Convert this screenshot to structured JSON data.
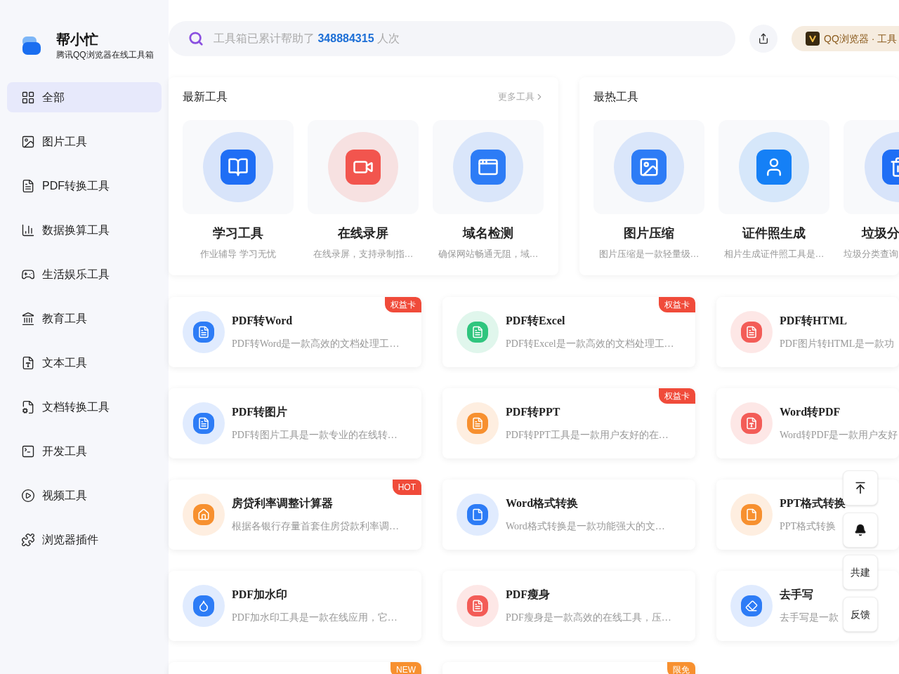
{
  "brand": {
    "name": "帮小忙",
    "subtitle": "腾讯QQ浏览器在线工具箱"
  },
  "sidebar": {
    "items": [
      {
        "label": "全部",
        "kind": "grid",
        "selected": true
      },
      {
        "label": "图片工具",
        "kind": "image",
        "selected": false
      },
      {
        "label": "PDF转换工具",
        "kind": "pdf",
        "selected": false
      },
      {
        "label": "数据换算工具",
        "kind": "chart",
        "selected": false
      },
      {
        "label": "生活娱乐工具",
        "kind": "life",
        "selected": false
      },
      {
        "label": "教育工具",
        "kind": "edu",
        "selected": false
      },
      {
        "label": "文本工具",
        "kind": "text",
        "selected": false
      },
      {
        "label": "文档转换工具",
        "kind": "doc",
        "selected": false
      },
      {
        "label": "开发工具",
        "kind": "code",
        "selected": false
      },
      {
        "label": "视频工具",
        "kind": "video",
        "selected": false
      },
      {
        "label": "浏览器插件",
        "kind": "plugin",
        "selected": false
      }
    ]
  },
  "search": {
    "prefix": "工具箱已累计帮助了",
    "count": "348884315",
    "suffix": "人次"
  },
  "promo": {
    "label": "QQ浏览器 · 工具"
  },
  "newest": {
    "title": "最新工具",
    "more": "更多工具",
    "items": [
      {
        "name": "学习工具",
        "desc": "作业辅导 学习无忧",
        "kind": "book",
        "color": "#1f6ef5"
      },
      {
        "name": "在线录屏",
        "desc": "在线录屏，支持录制指…",
        "kind": "video",
        "color": "#f2554e"
      },
      {
        "name": "域名检测",
        "desc": "确保网站畅通无阻，域…",
        "kind": "browser",
        "color": "#2d7cf6"
      }
    ]
  },
  "hottest": {
    "title": "最热工具",
    "items": [
      {
        "name": "图片压缩",
        "desc": "图片压缩是一款轻量级…",
        "kind": "image",
        "color": "#2d7cf6"
      },
      {
        "name": "证件照生成",
        "desc": "相片生成证件照工具是…",
        "kind": "person",
        "color": "#1580f6"
      },
      {
        "name": "垃圾分",
        "desc": "垃圾分类查询",
        "kind": "trash",
        "color": "#1f6ef5"
      }
    ]
  },
  "tools": [
    {
      "name": "PDF转Word",
      "desc": "PDF转Word是一款高效的文档处理工…",
      "kind": "pdf",
      "color": "#2d7cf6",
      "badge": {
        "text": "权益卡",
        "color": "#f04b3a"
      }
    },
    {
      "name": "PDF转Excel",
      "desc": "PDF转Excel是一款高效的文档处理工…",
      "kind": "pdf",
      "color": "#2fc57e",
      "badge": {
        "text": "权益卡",
        "color": "#f04b3a"
      }
    },
    {
      "name": "PDF转HTML",
      "desc": "PDF图片转HTML是一款功",
      "kind": "pdf",
      "color": "#f35c57"
    },
    {
      "name": "PDF转图片",
      "desc": "PDF转图片工具是一款专业的在线转…",
      "kind": "pdf",
      "color": "#2d7cf6"
    },
    {
      "name": "PDF转PPT",
      "desc": "PDF转PPT工具是一款用户友好的在…",
      "kind": "pdf",
      "color": "#f7902f",
      "badge": {
        "text": "权益卡",
        "color": "#f04b3a"
      }
    },
    {
      "name": "Word转PDF",
      "desc": "Word转PDF是一款用户友好",
      "kind": "word",
      "color": "#f35c57"
    },
    {
      "name": "房贷利率调整计算器",
      "desc": "根据各银行存量首套住房贷款利率调…",
      "kind": "house",
      "color": "#f7902f",
      "badge": {
        "text": "HOT",
        "color": "#f04b3a"
      }
    },
    {
      "name": "Word格式转换",
      "desc": "Word格式转换是一款功能强大的文…",
      "kind": "file",
      "color": "#2d7cf6"
    },
    {
      "name": "PPT格式转换",
      "desc": "PPT格式转换",
      "kind": "file",
      "color": "#f7902f"
    },
    {
      "name": "PDF加水印",
      "desc": "PDF加水印工具是一款在线应用，它…",
      "kind": "drop",
      "color": "#2d7cf6"
    },
    {
      "name": "PDF瘦身",
      "desc": "PDF瘦身是一款高效的在线工具，压…",
      "kind": "pdf",
      "color": "#f35c57"
    },
    {
      "name": "去手写",
      "desc": "去手写是一款",
      "kind": "eraser",
      "color": "#2d7cf6"
    }
  ],
  "partial_tools": [
    {
      "badge": {
        "text": "NEW",
        "color": "#f7902f"
      }
    },
    {
      "badge": {
        "text": "限免",
        "color": "#f7902f"
      }
    }
  ],
  "float_buttons": [
    {
      "kind": "top"
    },
    {
      "kind": "qq"
    },
    {
      "kind": "text",
      "label": "共建"
    },
    {
      "kind": "text",
      "label": "反馈"
    }
  ]
}
